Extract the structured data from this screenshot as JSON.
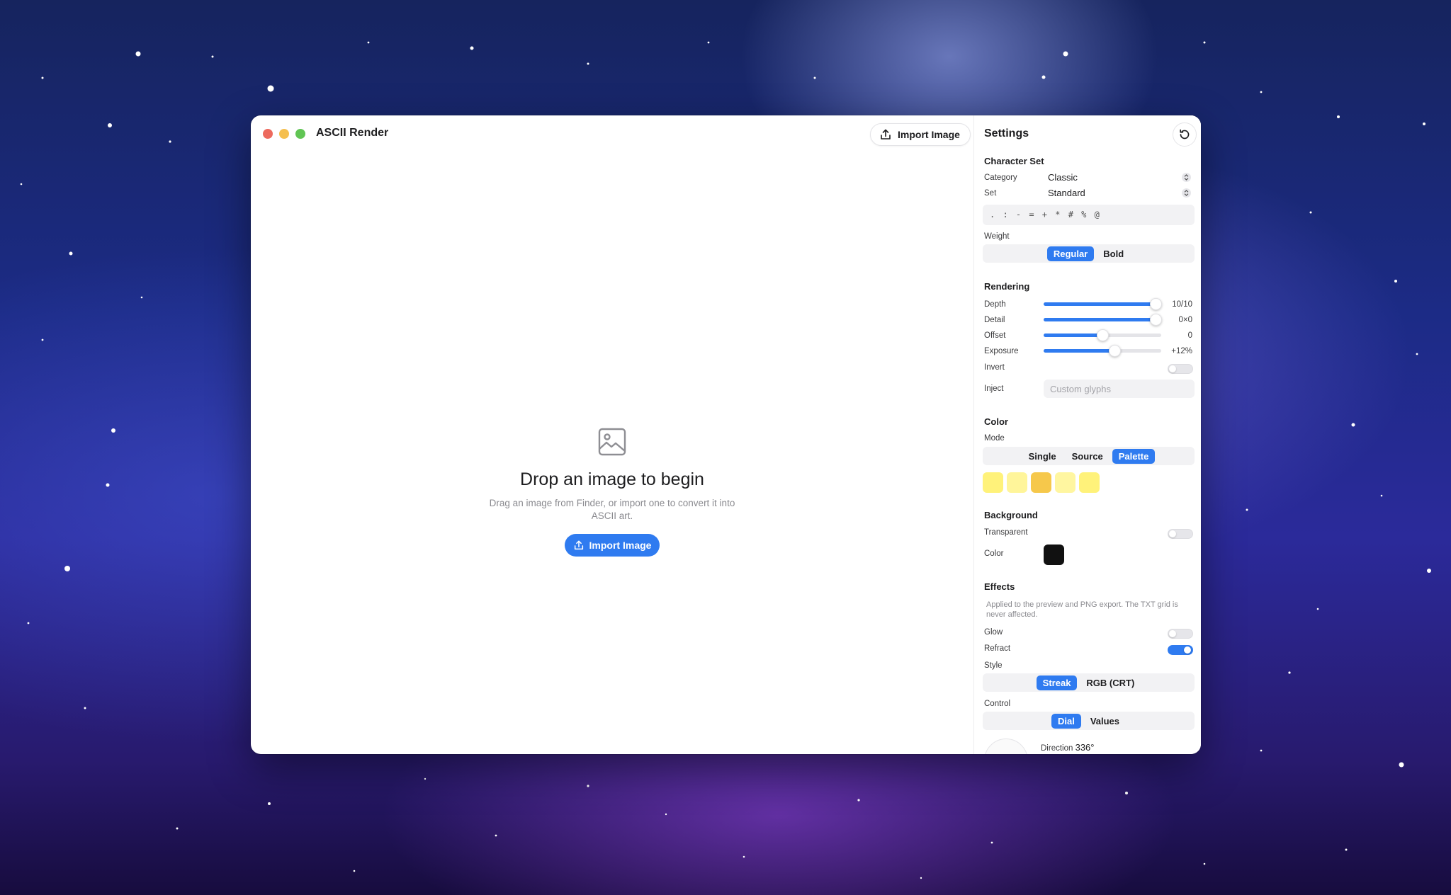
{
  "window": {
    "title": "ASCII Render",
    "import_button_label": "Import Image",
    "traffic_lights": [
      "close",
      "minimize",
      "zoom"
    ]
  },
  "drop_area": {
    "icon": "photo-icon",
    "title": "Drop an image to begin",
    "subtitle": "Drag an image from Finder, or import one to convert it into ASCII art.",
    "button_label": "Import Image"
  },
  "settings": {
    "title": "Settings",
    "reset_icon": "reset-icon",
    "character_set": {
      "heading": "Character Set",
      "category_label": "Category",
      "category_value": "Classic",
      "set_label": "Set",
      "set_value": "Standard",
      "glyphs": ". : - = + * # % @",
      "weight_label": "Weight",
      "weight_options": [
        "Regular",
        "Bold"
      ],
      "weight_selected": "Regular"
    },
    "rendering": {
      "heading": "Rendering",
      "sliders": [
        {
          "label": "Depth",
          "value": "10/10",
          "level": 0.95
        },
        {
          "label": "Detail",
          "value": "0×0",
          "level": 0.95
        },
        {
          "label": "Offset",
          "value": "0",
          "level": 0.5
        },
        {
          "label": "Exposure",
          "value": "+12%",
          "level": 0.6
        }
      ],
      "invert_label": "Invert",
      "invert_on": false,
      "inject_label": "Inject",
      "inject_placeholder": "Custom glyphs"
    },
    "color": {
      "heading": "Color",
      "mode_label": "Mode",
      "mode_options": [
        "Single",
        "Source",
        "Palette"
      ],
      "mode_selected": "Palette",
      "palette": [
        "#fff27a",
        "#fff59a",
        "#f6c84b",
        "#fff6a0",
        "#fff27a"
      ]
    },
    "background": {
      "heading": "Background",
      "transparent_label": "Transparent",
      "transparent_on": false,
      "color_label": "Color",
      "color_value": "#111111"
    },
    "effects": {
      "heading": "Effects",
      "note": "Applied to the preview and PNG export. The TXT grid is never affected.",
      "glow_label": "Glow",
      "glow_on": false,
      "refract_label": "Refract",
      "refract_on": true,
      "style_label": "Style",
      "style_options": [
        "Streak",
        "RGB (CRT)"
      ],
      "style_selected": "Streak",
      "control_label": "Control",
      "control_options": [
        "Dial",
        "Values"
      ],
      "control_selected": "Dial",
      "direction_label": "Direction",
      "direction_value": "336°"
    }
  },
  "colors": {
    "accent": "#2f7bf0"
  }
}
